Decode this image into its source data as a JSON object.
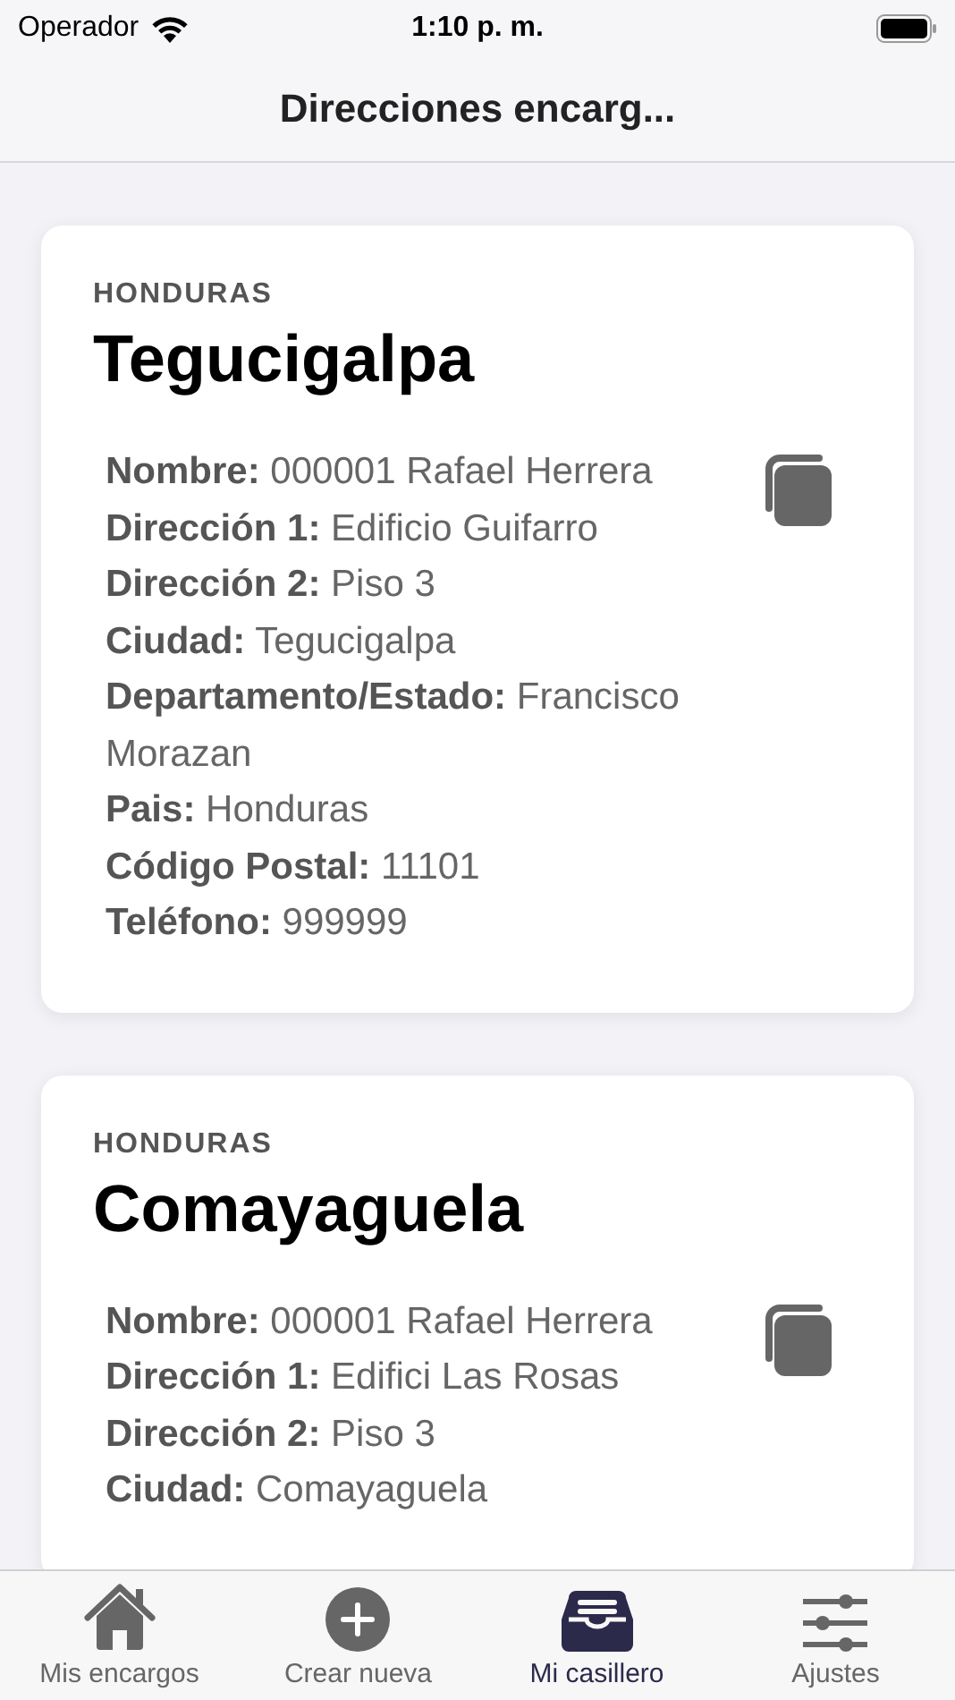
{
  "status_bar": {
    "carrier": "Operador",
    "time": "1:10 p. m."
  },
  "nav_bar": {
    "title": "Direcciones encarg..."
  },
  "addresses": [
    {
      "country": "HONDURAS",
      "city": "Tegucigalpa",
      "lines": [
        "**Nombre:** 000001 Rafael Herrera",
        "**Dirección 1:** Edificio Guifarro",
        "**Dirección 2:** Piso 3",
        "**Ciudad:** Tegucigalpa",
        "**Departamento/Estado:** Francisco Morazan",
        "**Pais:** Honduras",
        "**Código Postal:** 11101",
        "**Teléfono:** 999999"
      ]
    },
    {
      "country": "HONDURAS",
      "city": "Comayaguela",
      "lines": [
        "**Nombre:** 000001 Rafael Herrera",
        "**Dirección 1:** Edifici Las Rosas",
        "**Dirección 2:** Piso 3",
        "**Ciudad:** Comayaguela"
      ]
    }
  ],
  "tab_bar": [
    {
      "label": "Mis encargos",
      "selected": false
    },
    {
      "label": "Crear nueva",
      "selected": false
    },
    {
      "label": "Mi casillero",
      "selected": true
    },
    {
      "label": "Ajustes",
      "selected": false
    }
  ]
}
